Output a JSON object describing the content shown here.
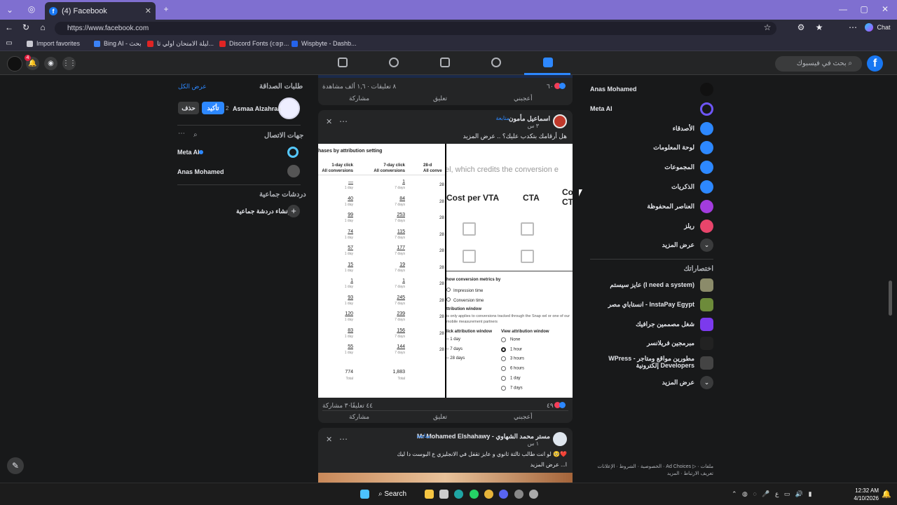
{
  "browser": {
    "tab_title": "(4) Facebook",
    "url": "https://www.facebook.com",
    "profile_label": "Chat",
    "bookmarks": [
      {
        "label": "Import favorites",
        "color": "#c9c9d2"
      },
      {
        "label": "Bing AI - بحث",
        "color": "#3b82f6"
      },
      {
        "label": "ليلة الامتحان اولي ثا...",
        "color": "#e02424"
      },
      {
        "label": "Discord Fonts (𝕔𝕠𝕡...",
        "color": "#e02424"
      },
      {
        "label": "Wispbyte - Dashb...",
        "color": "#2563eb"
      }
    ]
  },
  "fb_header": {
    "search_placeholder": "بحث في فيسبوك",
    "logo": "f",
    "notif_count": "4"
  },
  "left_col": {
    "friend_requests_title": "طلبات الصداقة",
    "see_all": "عرض الكل",
    "request": {
      "name": "Asmaa Alzahraa",
      "mutual": "2",
      "confirm": "تأكيد",
      "delete": "حذف"
    },
    "contacts_title": "جهات الاتصال",
    "contacts": [
      {
        "name": "Meta AI"
      },
      {
        "name": "Anas Mohamed"
      }
    ],
    "group_chats_title": "دردشات جماعية",
    "create_group": "إنشاء دردشة جماعية"
  },
  "feed": {
    "top_stats": {
      "reactions": "٦٠",
      "comments_views": "٨ تعليقات · ١,٦ ألف مشاهدة"
    },
    "actions": {
      "like": "أعجبني",
      "comment": "تعليق",
      "share": "مشاركة"
    },
    "post1": {
      "author": "اسماعيل مأمون",
      "follow": "متابعة",
      "time": "٣ س",
      "text": "هل أرقامك بتكدب عليك؟ .. عرض المزيد",
      "reactions": "٤٩",
      "comments": "٤٤ تعليقًا",
      "shares": "٣٠ مشاركة",
      "image_left": {
        "heading": "hases by attribution setting",
        "columns": [
          {
            "title": "1-day click",
            "sub": "All conversions"
          },
          {
            "title": "7-day click",
            "sub": "All conversions"
          },
          {
            "title": "28-d",
            "sub": "All conve"
          }
        ],
        "rows": [
          {
            "a": "—",
            "b": "1"
          },
          {
            "a": "40",
            "b": "84"
          },
          {
            "a": "99",
            "b": "253"
          },
          {
            "a": "74",
            "b": "115"
          },
          {
            "a": "57",
            "b": "177"
          },
          {
            "a": "15",
            "b": "19"
          },
          {
            "a": "1",
            "b": "1"
          },
          {
            "a": "93",
            "b": "245"
          },
          {
            "a": "120",
            "b": "239"
          },
          {
            "a": "83",
            "b": "156"
          },
          {
            "a": "55",
            "b": "144"
          }
        ],
        "sub_a": "1 day",
        "sub_b": "7 days",
        "col3": "28",
        "total_a": "774",
        "total_b": "1,883",
        "total_label": "Total"
      },
      "image_right": {
        "banner": "el, which credits the conversion e",
        "col1": "Cost per VTA",
        "col2": "CTA",
        "col3": "Co CT",
        "metrics_title": "how conversion metrics by",
        "opt1": "Impression time",
        "opt2": "Conversion time",
        "window_title": "ttribution window",
        "window_desc": "is only applies to conversions tracked through the Snap xel or one of our mobile measurement partners",
        "click_title": "lick attribution window",
        "view_title": "View attribution window",
        "click_opts": [
          "1 day",
          "7 days",
          "28 days"
        ],
        "view_opts": [
          "None",
          "1 hour",
          "3 hours",
          "6 hours",
          "1 day",
          "7 days"
        ]
      }
    },
    "post2": {
      "author": "Mr Mohamed Elshahawy - مستر محمد الشهاوي",
      "follow": "متابعة",
      "time": "١ س",
      "text": "لو انت طالب تالتة ثانوي و عايز تقفل في الانجليزي ع البوست دا ليك 🥺❤️",
      "more": "ا... عرض المزيد"
    }
  },
  "right_sidebar": {
    "items": [
      {
        "label": "Anas Mohamed",
        "color": "#111"
      },
      {
        "label": "Meta AI",
        "color": "#6e56f8"
      },
      {
        "label": "الأصدقاء",
        "color": "#2d88ff"
      },
      {
        "label": "لوحة المعلومات",
        "color": "#2d88ff"
      },
      {
        "label": "المجموعات",
        "color": "#2d88ff"
      },
      {
        "label": "الذكريات",
        "color": "#2d88ff"
      },
      {
        "label": "العناصر المحفوظة",
        "color": "#a33cde"
      },
      {
        "label": "ريلز",
        "color": "#e8456b"
      },
      {
        "label": "عرض المزيد",
        "color": "#3a3b3c"
      }
    ],
    "shortcuts_title": "اختصاراتك",
    "shortcuts": [
      {
        "label": "عايز سيستم (I need a system)",
        "color": "#8b8b6a"
      },
      {
        "label": "انستاباي مصر - InstaPay Egypt",
        "color": "#6d8b3a"
      },
      {
        "label": "شغل مصممين جرافيك",
        "color": "#7c3aed"
      },
      {
        "label": "مبرمجين فريلانسر",
        "color": "#222"
      },
      {
        "label": "WPress - مطورين مواقع ومتاجر إلكترونية Developers",
        "color": "#444"
      },
      {
        "label": "عرض المزيد",
        "color": "#3a3b3c"
      }
    ],
    "footer": "الخصوصية · الشروط · الإعلانات · Ad Choices ▷ · ملفات تعريف الارتباط · المزيد"
  },
  "taskbar": {
    "search": "Search",
    "time": "12:32 AM",
    "date": "4/10/2026"
  }
}
